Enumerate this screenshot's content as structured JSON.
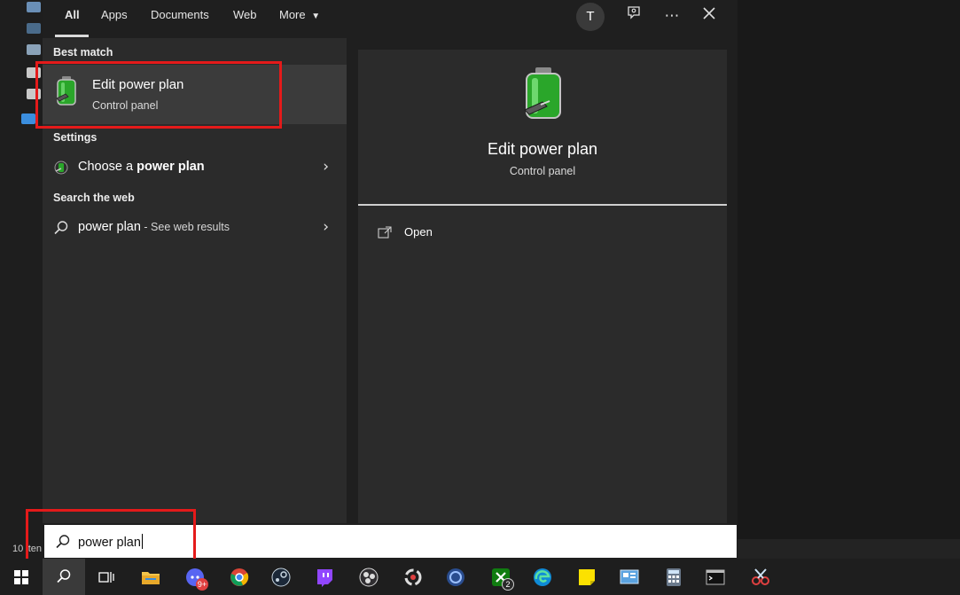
{
  "tabs": [
    {
      "label": "All"
    },
    {
      "label": "Apps"
    },
    {
      "label": "Documents"
    },
    {
      "label": "Web"
    },
    {
      "label": "More"
    }
  ],
  "user": {
    "avatar_letter": "T"
  },
  "sections": {
    "best_match": "Best match",
    "settings": "Settings",
    "search_web": "Search the web"
  },
  "best_match": {
    "title": "Edit power plan",
    "subtitle": "Control panel"
  },
  "settings_item": {
    "prefix": "Choose a ",
    "bold": "power plan"
  },
  "web_item": {
    "query": "power plan",
    "suffix": " - See web results"
  },
  "preview": {
    "title": "Edit power plan",
    "subtitle": "Control panel",
    "action_open": "Open"
  },
  "search": {
    "value": "power plan"
  },
  "status_bar": {
    "text": "10 iten"
  },
  "taskbar": {
    "badges": {
      "discord": "9+",
      "xbox": "2"
    }
  },
  "colors": {
    "highlight": "#e41a1a",
    "accent_green": "#3db33d"
  }
}
